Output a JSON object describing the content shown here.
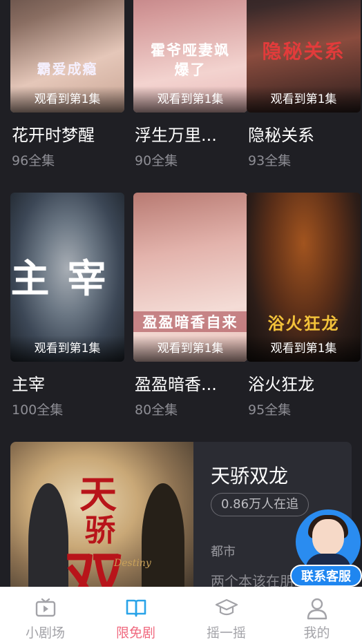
{
  "grid": [
    {
      "title": "花开时梦醒",
      "episodes": "96全集",
      "progress": "观看到第1集",
      "poster_text": "霸爱成瘾",
      "colors": [
        "#8a6e62",
        "#e5c7b9",
        "#3a2b28"
      ]
    },
    {
      "title": "浮生万里...",
      "episodes": "90全集",
      "progress": "观看到第1集",
      "poster_text": "霍爷哑妻飒爆了",
      "colors": [
        "#d49a9a",
        "#f3d3cf",
        "#a35b62"
      ]
    },
    {
      "title": "隐秘关系",
      "episodes": "93全集",
      "progress": "观看到第1集",
      "poster_text": "隐秘关系",
      "colors": [
        "#3b2a2a",
        "#8a4c3e",
        "#1a1416"
      ]
    },
    {
      "title": "主宰",
      "episodes": "100全集",
      "progress": "观看到第1集",
      "poster_text": "主宰",
      "colors": [
        "#3c4756",
        "#a8aeb5",
        "#1e242b"
      ]
    },
    {
      "title": "盈盈暗香...",
      "episodes": "80全集",
      "progress": "观看到第1集",
      "poster_text": "盈盈暗香自来",
      "colors": [
        "#e3b3ac",
        "#f4dcd6",
        "#b87a72"
      ]
    },
    {
      "title": "浴火狂龙",
      "episodes": "95全集",
      "progress": "观看到第1集",
      "poster_text": "浴火狂龙",
      "colors": [
        "#2c1d18",
        "#a2541f",
        "#140f0d"
      ]
    }
  ],
  "featured": {
    "title": "天骄双龙",
    "followers": "0.86万人在追",
    "genre": "都市",
    "description": "两个本该在朋...",
    "poster_chars": [
      "天",
      "骄",
      "双"
    ],
    "poster_text": "Destiny"
  },
  "customer_service": {
    "label": "联系客服"
  },
  "nav": [
    {
      "label": "小剧场",
      "icon": "tv-icon",
      "active": false
    },
    {
      "label": "限免剧",
      "icon": "book-icon",
      "active": true
    },
    {
      "label": "摇一摇",
      "icon": "cap-icon",
      "active": false
    },
    {
      "label": "我的",
      "icon": "user-icon",
      "active": false
    }
  ],
  "colors": {
    "background": "#1f1f24",
    "accent": "#f0697f",
    "active_icon": "#29a3e8",
    "cs_blue": "#1f86f0"
  }
}
